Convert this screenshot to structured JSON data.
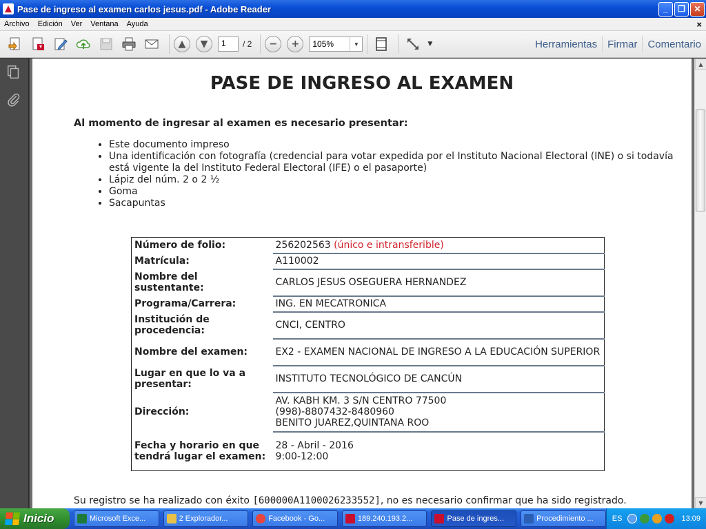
{
  "window": {
    "title": "Pase de ingreso al examen carlos jesus.pdf - Adobe Reader",
    "min": "_",
    "max": "❐",
    "close": "✕"
  },
  "menu": [
    "Archivo",
    "Edición",
    "Ver",
    "Ventana",
    "Ayuda"
  ],
  "menu_close": "×",
  "toolbar": {
    "page_current": "1",
    "page_total": "/ 2",
    "zoom": "105%",
    "zoom_arrow": "▼",
    "prev_icon": "▲",
    "next_icon": "▼",
    "zoom_out_icon": "−",
    "zoom_in_icon": "+",
    "more_arrow": "▼",
    "links": [
      "Herramientas",
      "Firmar",
      "Comentario"
    ]
  },
  "scrollbar": {
    "up": "▲",
    "down": "▼"
  },
  "document": {
    "title": "PASE DE INGRESO AL EXAMEN",
    "intro": "Al momento de ingresar al examen es necesario presentar:",
    "requirements": [
      "Este documento impreso",
      "Una identificación con fotografía (credencial para votar expedida por el Instituto Nacional Electoral (INE) o si todavía está vigente la del Instituto Federal Electoral (IFE) o el pasaporte)",
      "Lápiz del núm. 2 o 2 ½",
      "Goma",
      "Sacapuntas"
    ],
    "rows": [
      {
        "label": "Número de folio:",
        "value": "256202563",
        "note": "(único e intransferible)"
      },
      {
        "label": "Matrícula:",
        "value": "A110002"
      },
      {
        "label": "Nombre del sustentante:",
        "value": "CARLOS JESUS OSEGUERA HERNANDEZ"
      },
      {
        "label": "Programa/Carrera:",
        "value": "ING. EN MECATRONICA"
      },
      {
        "label": "Institución de procedencia:",
        "value": "CNCI, CENTRO"
      },
      {
        "label": "Nombre del examen:",
        "value": "EX2 - EXAMEN NACIONAL DE INGRESO A LA EDUCACIÓN SUPERIOR"
      },
      {
        "label": "Lugar en que lo va a presentar:",
        "value": "INSTITUTO TECNOLÓGICO DE CANCÚN"
      },
      {
        "label": "Dirección:",
        "lines": [
          "AV. KABH KM. 3 S/N CENTRO 77500",
          "(998)-8807432-8480960",
          "BENITO JUAREZ,QUINTANA ROO"
        ]
      },
      {
        "label": "Fecha y horario en que tendrá lugar el examen:",
        "lines": [
          "28 - Abril - 2016",
          "9:00-12:00"
        ]
      }
    ],
    "footer_pre": "Su registro se ha realizado con éxito ",
    "footer_code": "[600000A1100026233552]",
    "footer_post": ", no es necesario confirmar que ha sido registrado."
  },
  "taskbar": {
    "start": "Inicio",
    "tasks": [
      {
        "label": "Microsoft Exce...",
        "color": "#1e7a3a"
      },
      {
        "label": "2 Explorador...",
        "color": "#e8c14a"
      },
      {
        "label": "Facebook - Go...",
        "color": "#e8453c"
      },
      {
        "label": "189.240.193.2...",
        "color": "#c8102e"
      },
      {
        "label": "Pase de ingres...",
        "color": "#c8102e",
        "active": true
      },
      {
        "label": "Procedimiento ...",
        "color": "#2b5fb4"
      }
    ],
    "lang": "ES",
    "clock": "13:09"
  }
}
